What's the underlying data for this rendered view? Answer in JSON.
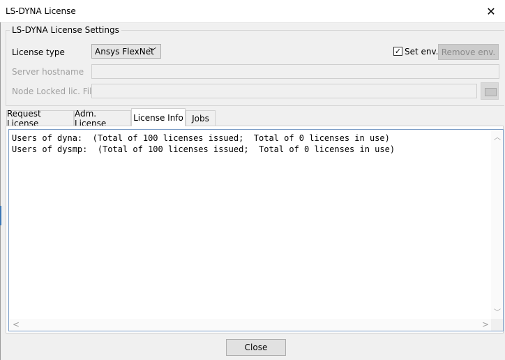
{
  "window": {
    "title": "LS-DYNA License",
    "close_glyph": "✕"
  },
  "settings": {
    "group_title": "LS-DYNA License Settings",
    "license_type_label": "License type",
    "license_type_value": "Ansys FlexNet",
    "license_type_arrow": "﹀",
    "set_env_checked": true,
    "set_env_check_glyph": "✓",
    "set_env_label": "Set env.",
    "remove_env_label": "Remove env.",
    "server_hostname_label": "Server hostname",
    "server_hostname_value": "",
    "node_locked_label": "Node Locked lic. File",
    "node_locked_value": "",
    "browse_icon": "folder-icon"
  },
  "tabs": [
    {
      "label": "Request License",
      "active": false
    },
    {
      "label": "Adm. License",
      "active": false
    },
    {
      "label": "License Info",
      "active": true
    },
    {
      "label": "Jobs",
      "active": false
    }
  ],
  "license_info": {
    "lines": [
      "Users of dyna:  (Total of 100 licenses issued;  Total of 0 licenses in use)",
      "Users of dysmp:  (Total of 100 licenses issued;  Total of 0 licenses in use)"
    ]
  },
  "scroll": {
    "up": "︿",
    "down": "﹀",
    "left": "<",
    "right": ">"
  },
  "footer": {
    "close_label": "Close"
  }
}
